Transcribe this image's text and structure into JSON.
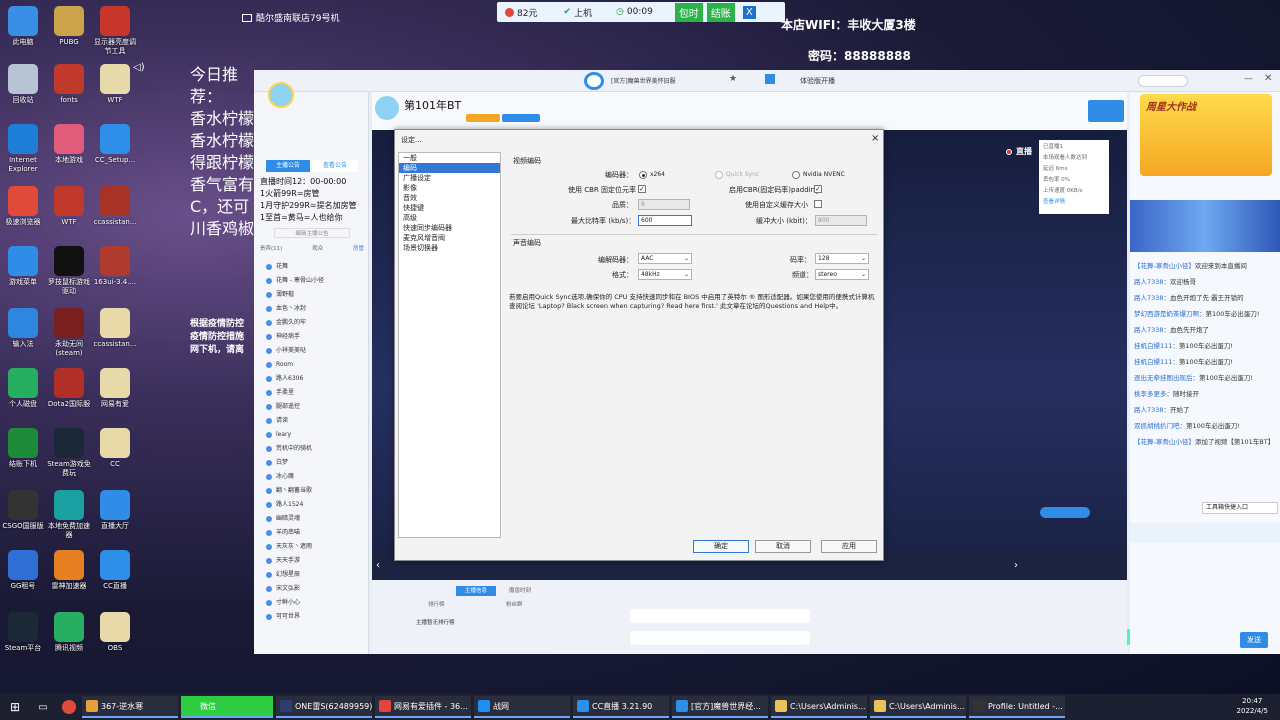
{
  "desktop_icons": [
    {
      "label": "此电脑",
      "color": "#3a8ee6"
    },
    {
      "label": "PUBG",
      "color": "#caa34a"
    },
    {
      "label": "显示器亮度调节工具",
      "color": "#c8352b"
    },
    {
      "label": "回收站",
      "color": "#b8c4d4"
    },
    {
      "label": "fonts",
      "color": "#c0392b"
    },
    {
      "label": "WTF",
      "color": "#e8d9a8"
    },
    {
      "label": "Internet Explorer",
      "color": "#1f7fd8"
    },
    {
      "label": "本地游戏",
      "color": "#e05c7a"
    },
    {
      "label": "CC_Setup...",
      "color": "#2d8fe8"
    },
    {
      "label": "极速浏览器",
      "color": "#e04a3b"
    },
    {
      "label": "WTF",
      "color": "#c0392b"
    },
    {
      "label": "ccassistan...",
      "color": "#a93226"
    },
    {
      "label": "游戏菜单",
      "color": "#2f8de8"
    },
    {
      "label": "罗技鼠标游戏驱动",
      "color": "#111111"
    },
    {
      "label": "163ui-3.4....",
      "color": "#b03a2e"
    },
    {
      "label": "输入法",
      "color": "#2e86de"
    },
    {
      "label": "永劫无间(steam)",
      "color": "#7a1e1e"
    },
    {
      "label": "ccassistan...",
      "color": "#e8d9a8"
    },
    {
      "label": "个人磁盘",
      "color": "#27ae60"
    },
    {
      "label": "Dota2国际服",
      "color": "#b03028"
    },
    {
      "label": "网易有爱",
      "color": "#e8d9a8"
    },
    {
      "label": "结账下机",
      "color": "#1e8b3a"
    },
    {
      "label": "Steam游戏免费玩",
      "color": "#1b2838"
    },
    {
      "label": "CC",
      "color": "#e8d9a8"
    },
    {
      "label": "CSGO国服版",
      "color": "#333333"
    },
    {
      "label": "本地免费加速器",
      "color": "#19a0a0"
    },
    {
      "label": "直播大厅",
      "color": "#2f8de8"
    },
    {
      "label": "GG租号",
      "color": "#2f6fd3"
    },
    {
      "label": "雷神加速器",
      "color": "#e67e22"
    },
    {
      "label": "CC直播",
      "color": "#2d8fe8"
    },
    {
      "label": "Steam平台",
      "color": "#1b2838"
    },
    {
      "label": "腾讯视频",
      "color": "#27ae60"
    },
    {
      "label": "OBS",
      "color": "#e8d9a8"
    }
  ],
  "top_bar": {
    "machine": "酷尔盛南联店79号机",
    "balance": "82元",
    "status": "上机",
    "time": "00:09",
    "package": "包时",
    "checkout": "结账",
    "close": "X",
    "wifi": "本店WIFI：丰收大厦3楼",
    "password": "密码：88888888"
  },
  "desktop_text": {
    "recommend_lines": [
      "今日推荐：",
      "香水柠檬",
      "香水柠檬",
      "得跟柠檬",
      "香气富有",
      "C，还可",
      "川香鸡椒"
    ],
    "notice_lines": [
      "根据疫情防控",
      "疫情防控措施",
      "网下机，请离"
    ]
  },
  "cc_window": {
    "tab_title": "[官方]魔兽世界美怀旧服",
    "mode": "体验版开播",
    "room_title": "第101年BT",
    "room_tag": "花舞 - 寒骨山小径",
    "live_label": "直播",
    "announcement_btn": "主播公告",
    "notice_btn": "查看公告",
    "left_tabs": [
      "主播公告",
      "查看公告"
    ],
    "announcement": "直播时间12：00-00:00\n1火箭99R=房管\n1月守护299R=提名加房管\n1至首=黄马=人也给你",
    "edit_notice": "编辑主播公告",
    "user_tabs": [
      "贵宾(11)",
      "观众",
      "房管"
    ],
    "users": [
      "花舞",
      "花舞 - 寒骨山小径",
      "薄野楷",
      "血色丶冰封",
      "金鹏久的牢",
      "神经病手",
      "小祥美美哒",
      "Room",
      "路人6306",
      "手柔里",
      "腿部遥控",
      "请读",
      "leary",
      "荒机中的骑机",
      "白梦",
      "冰心魔",
      "翻丶翻蓄当歌",
      "路人1524",
      "幽暗灵魂",
      "羊肉串喵",
      "天灰灰丶遮雨",
      "天天手游",
      "幻想星辰",
      "宋文弘影",
      "寸鲜小心",
      "可可世界"
    ],
    "bottom_tabs": [
      "主播信息",
      "魔兽时刻"
    ],
    "ranks": [
      "排行榜",
      "粉丝群"
    ],
    "rank_hint": "主播暂无排行榜",
    "chat_lines": [
      {
        "user": "【花舞-寒骨山小径】",
        "text": "欢迎来到本直播间"
      },
      {
        "user": "路人7338：",
        "text": "欢迎杨哥"
      },
      {
        "user": "路人7338：",
        "text": "血色开炮了先 霸王开锁的"
      },
      {
        "user": "梦幻西游是奶茶爆刀啊：",
        "text": "第100车必出蛋刀!"
      },
      {
        "user": "路人7338：",
        "text": "血色先开炮了"
      },
      {
        "user": "挂机白嫖111：",
        "text": "第100车必出蛋刀!"
      },
      {
        "user": "挂机白嫖111：",
        "text": "第100车必出蛋刀!"
      },
      {
        "user": "逐出无牵挂图出现后：",
        "text": "第100车必出蛋刀!"
      },
      {
        "user": "桃李多更多：",
        "text": "随时接开"
      },
      {
        "user": "路人7338：",
        "text": "开始了"
      },
      {
        "user": "双抓胡桃扒门吧：",
        "text": "第100车必出蛋刀!"
      },
      {
        "user": "【花舞-寒骨山小径】",
        "text": "添加了视频【第101车BT】"
      }
    ],
    "shortcut_tip": "工具箱快捷入口",
    "send_btn": "发送",
    "event_banner": "周星大作战"
  },
  "stats_box": {
    "title": "直播",
    "lines": [
      "已直播1",
      "本场观看人数达到",
      "延迟 6ms",
      "丢包率 0%",
      "上传速度 0KB/s"
    ],
    "detail": "查看详情"
  },
  "dialog": {
    "title": "设定...",
    "categories": [
      "一般",
      "编码",
      "广播设定",
      "影像",
      "音效",
      "快捷键",
      "高级",
      "快速同步编码器",
      "麦克风增音阀",
      "场景切换器"
    ],
    "video_section": "视频编码",
    "encoder_label": "编码器：",
    "encoder_options": [
      "x264",
      "Quick Sync",
      "Nvidia NVENC"
    ],
    "cbr_label": "使用 CBR 固定位元率",
    "cbr_padding_label": "启用CBR(固定码率)padding",
    "quality_label": "品质：",
    "quality_value": "8",
    "custom_buffer_label": "使用自定义缓存大小",
    "max_bitrate_label": "最大比特率 (kb/s)：",
    "max_bitrate_value": "600",
    "buffer_label": "缓冲大小 (kbit)：",
    "buffer_value": "800",
    "audio_section": "声音编码",
    "codec_label": "编解码器：",
    "codec_value": "AAC",
    "bitrate_label": "码率：",
    "bitrate_value": "128",
    "format_label": "格式：",
    "format_value": "48kHz",
    "channel_label": "频道：",
    "channel_value": "stereo",
    "info_text": "若要启用Quick Sync选项,确保你的 CPU 支持快速同步和在 BIOS 中启用了英特尔 ® 图形适配器。如果您使用的便携式计算机查阅论坛 'Laptop? Black screen when capturing? Read here first.' 此文章在论坛的Questions and Help中。",
    "ok": "确定",
    "cancel": "取消",
    "apply": "应用",
    "close": "×"
  },
  "taskbar": {
    "items": [
      {
        "label": "367-逆水寒",
        "color": "#e8a13a"
      },
      {
        "label": "微信",
        "color": "#2ecc40"
      },
      {
        "label": "ONE雷S(62489959)",
        "color": "#2c3e70"
      },
      {
        "label": "网易有爱插件 - 36...",
        "color": "#e0453b"
      },
      {
        "label": "战网",
        "color": "#1f8ef0"
      },
      {
        "label": "CC直播 3.21.90",
        "color": "#2d8fe8"
      },
      {
        "label": "[官方]魔兽世界经...",
        "color": "#2d8fe8"
      },
      {
        "label": "C:\\Users\\Adminis...",
        "color": "#e8c35a"
      },
      {
        "label": "C:\\Users\\Adminis...",
        "color": "#e8c35a"
      },
      {
        "label": "Profile: Untitled -...",
        "color": "#333333"
      }
    ],
    "clock_time": "20:47",
    "clock_date": "2022/4/5"
  }
}
